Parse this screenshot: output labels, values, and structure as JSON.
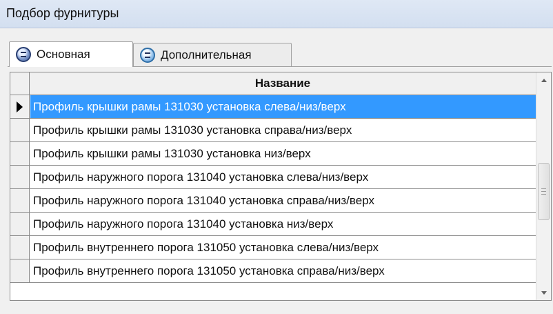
{
  "window": {
    "title": "Подбор фурнитуры"
  },
  "tabs": [
    {
      "label": "Основная",
      "icon": "disk-icon",
      "active": true
    },
    {
      "label": "Дополнительная",
      "icon": "disk-icon",
      "active": false
    }
  ],
  "grid": {
    "column_header": "Название",
    "selected_row": 0,
    "rows": [
      "Профиль крышки рамы 131030 установка слева/низ/верх",
      "Профиль крышки рамы 131030 установка справа/низ/верх",
      "Профиль крышки рамы 131030 установка низ/верх",
      "Профиль наружного порога 131040 установка слева/низ/верх",
      "Профиль наружного порога 131040 установка справа/низ/верх",
      "Профиль наружного порога 131040 установка низ/верх",
      "Профиль внутреннего порога 131050 установка слева/низ/верх",
      "Профиль внутреннего порога 131050 установка справа/низ/верх"
    ]
  },
  "colors": {
    "selection": "#3399ff",
    "titlebar": "#d9e4f3"
  }
}
